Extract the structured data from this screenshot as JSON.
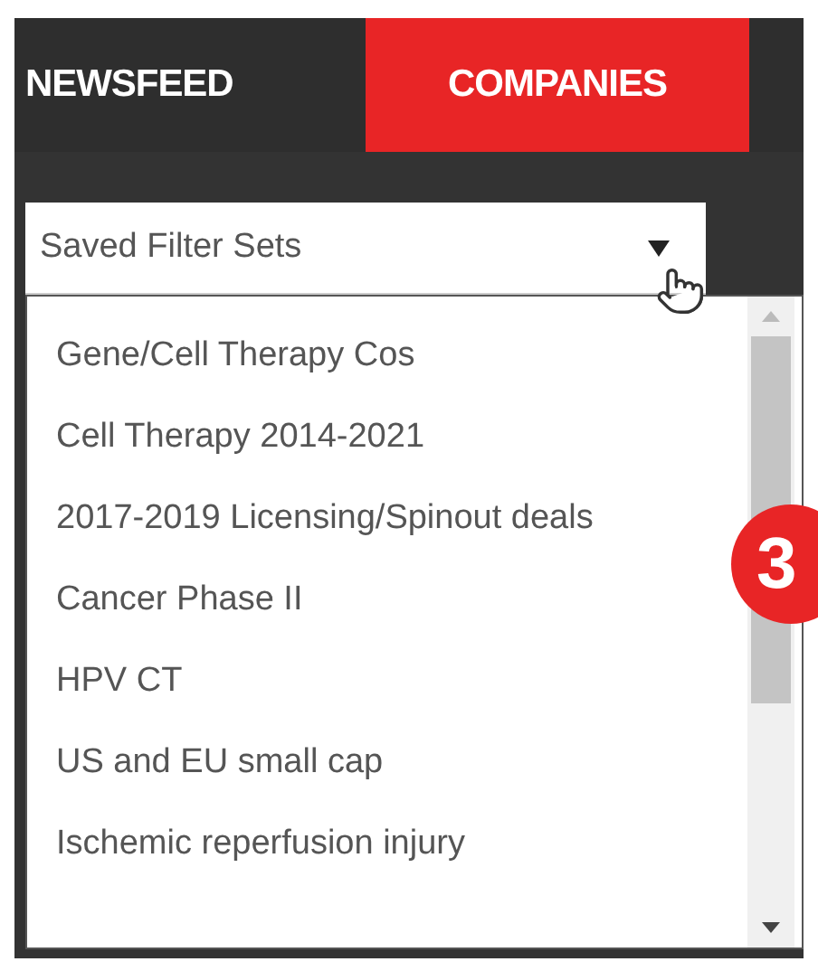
{
  "tabs": [
    {
      "label": "NEWSFEED",
      "selected": false
    },
    {
      "label": "COMPANIES",
      "selected": true
    }
  ],
  "filter_select": {
    "value": "Saved Filter Sets",
    "expanded": true
  },
  "options": [
    "Gene/Cell Therapy Cos",
    "Cell Therapy 2014-2021",
    "2017-2019 Licensing/Spinout deals",
    "Cancer Phase II",
    "HPV CT",
    "US and EU small cap",
    "Ischemic reperfusion injury"
  ],
  "callout": {
    "label": "3"
  }
}
